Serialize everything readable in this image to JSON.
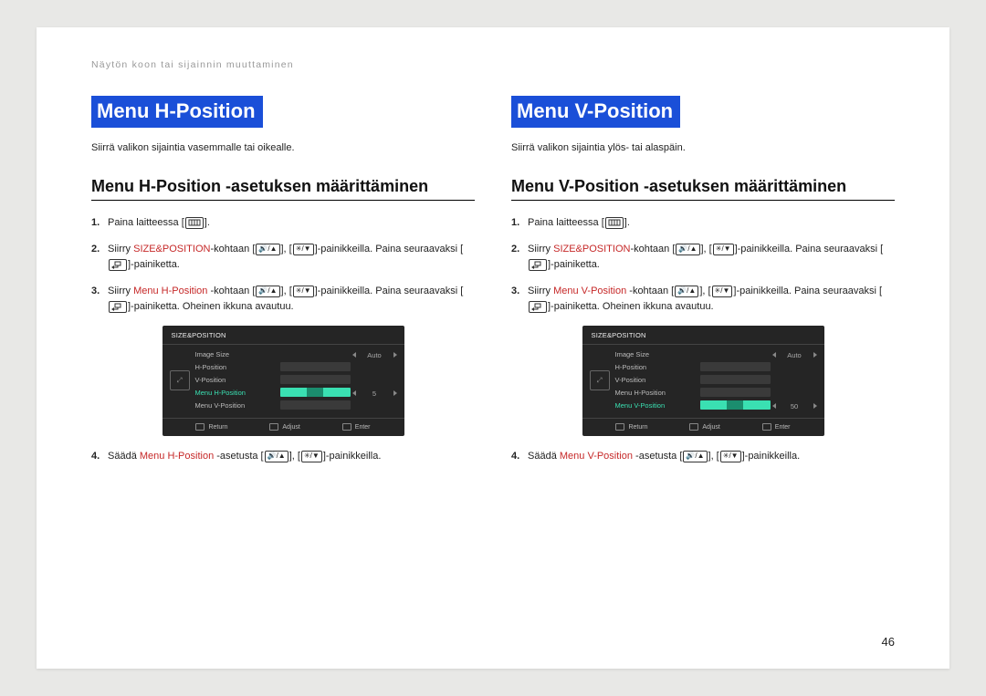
{
  "header": "Näytön koon tai sijainnin muuttaminen",
  "page_number": "46",
  "left": {
    "title": "Menu H-Position",
    "desc": "Siirrä valikon sijaintia vasemmalle tai oikealle.",
    "subtitle": "Menu H-Position -asetuksen määrittäminen",
    "steps": {
      "s1": "Paina laitteessa [",
      "s1b": "].",
      "s2a": "Siirry ",
      "s2_size": "SIZE&POSITION",
      "s2b": "-kohtaan [",
      "s2c": "], [",
      "s2d": "]-painikkeilla. Paina seuraavaksi [",
      "s2e": "]-painiketta.",
      "s3a": "Siirry ",
      "s3_item": "Menu H-Position",
      "s3b": " -kohtaan [",
      "s3c": "], [",
      "s3d": "]-painikkeilla. Paina seuraavaksi [",
      "s3e": "]-painiketta. Oheinen ikkuna avautuu.",
      "s4a": "Säädä ",
      "s4_item": "Menu H-Position",
      "s4b": " -asetusta [",
      "s4c": "], [",
      "s4d": "]-painikkeilla."
    },
    "osd": {
      "head": "SIZE&POSITION",
      "rows": [
        "Image Size",
        "H-Position",
        "V-Position",
        "Menu H-Position",
        "Menu V-Position"
      ],
      "vals": [
        "Auto",
        "",
        "",
        "",
        ""
      ],
      "sel_index": 3,
      "midnum": "5",
      "foot": [
        "Return",
        "Adjust",
        "Enter"
      ]
    }
  },
  "right": {
    "title": "Menu V-Position",
    "desc": "Siirrä valikon sijaintia ylös- tai alaspäin.",
    "subtitle": "Menu V-Position -asetuksen määrittäminen",
    "steps": {
      "s1": "Paina laitteessa [",
      "s1b": "].",
      "s2a": "Siirry ",
      "s2_size": "SIZE&POSITION",
      "s2b": "-kohtaan [",
      "s2c": "], [",
      "s2d": "]-painikkeilla. Paina seuraavaksi [",
      "s2e": "]-painiketta.",
      "s3a": "Siirry ",
      "s3_item": "Menu V-Position",
      "s3b": " -kohtaan [",
      "s3c": "], [",
      "s3d": "]-painikkeilla. Paina seuraavaksi [",
      "s3e": "]-painiketta.  Oheinen ikkuna avautuu.",
      "s4a": "Säädä ",
      "s4_item": "Menu V-Position",
      "s4b": " -asetusta [",
      "s4c": "], [",
      "s4d": "]-painikkeilla."
    },
    "osd": {
      "head": "SIZE&POSITION",
      "rows": [
        "Image Size",
        "H-Position",
        "V-Position",
        "Menu H-Position",
        "Menu V-Position"
      ],
      "vals": [
        "Auto",
        "",
        "",
        "",
        "50"
      ],
      "sel_index": 4,
      "midnum": "",
      "foot": [
        "Return",
        "Adjust",
        "Enter"
      ]
    }
  }
}
